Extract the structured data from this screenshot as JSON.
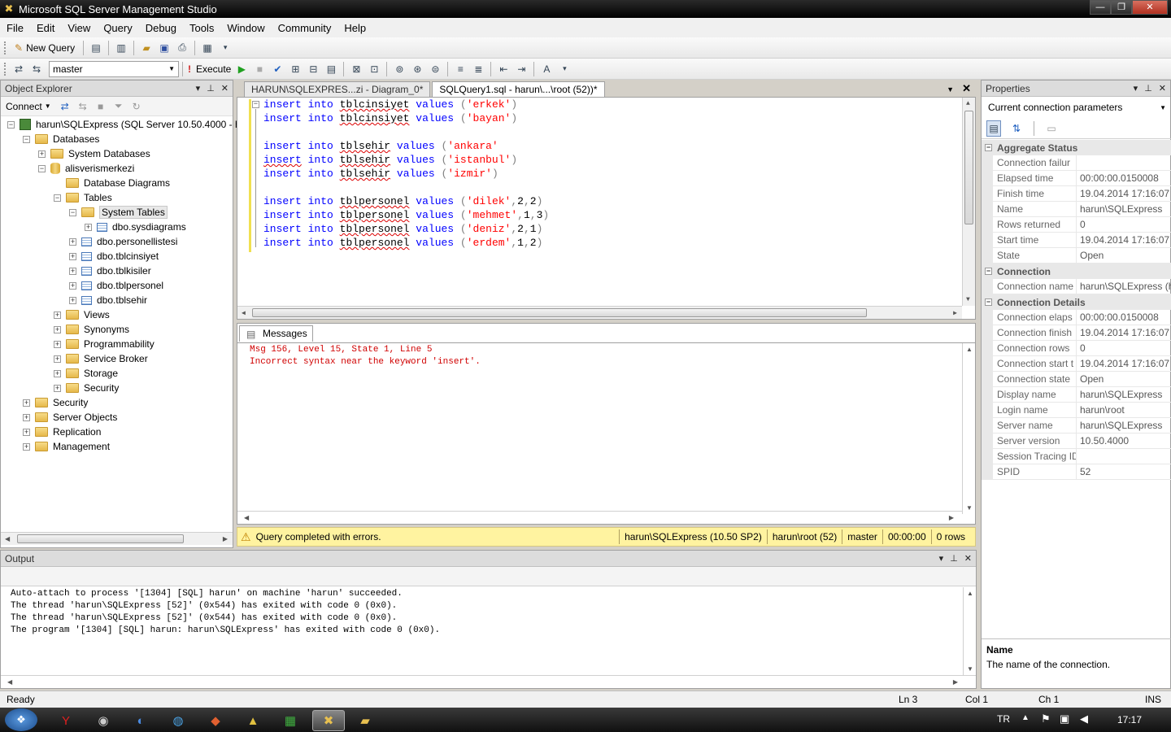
{
  "window": {
    "title": "Microsoft SQL Server Management Studio",
    "minimize": "—",
    "maximize": "❐",
    "close": "✕"
  },
  "menu": [
    "File",
    "Edit",
    "View",
    "Query",
    "Debug",
    "Tools",
    "Window",
    "Community",
    "Help"
  ],
  "toolbar1": {
    "new_query": "New Query"
  },
  "toolbar2": {
    "database": "master",
    "execute": "Execute"
  },
  "object_explorer": {
    "title": "Object Explorer",
    "connect": "Connect",
    "tree": [
      {
        "label": "harun\\SQLExpress (SQL Server 10.50.4000 - ha",
        "icon": "server",
        "exp": "−",
        "lvl": 0
      },
      {
        "label": "Databases",
        "icon": "folder",
        "exp": "−",
        "lvl": 1
      },
      {
        "label": "System Databases",
        "icon": "folder",
        "exp": "+",
        "lvl": 2
      },
      {
        "label": "alisverismerkezi",
        "icon": "db",
        "exp": "−",
        "lvl": 2
      },
      {
        "label": "Database Diagrams",
        "icon": "folder",
        "exp": "",
        "lvl": 3
      },
      {
        "label": "Tables",
        "icon": "folder",
        "exp": "−",
        "lvl": 3
      },
      {
        "label": "System Tables",
        "icon": "folder",
        "exp": "−",
        "lvl": 4,
        "selected": true
      },
      {
        "label": "dbo.sysdiagrams",
        "icon": "table",
        "exp": "+",
        "lvl": 5
      },
      {
        "label": "dbo.personellistesi",
        "icon": "table",
        "exp": "+",
        "lvl": 4
      },
      {
        "label": "dbo.tblcinsiyet",
        "icon": "table",
        "exp": "+",
        "lvl": 4
      },
      {
        "label": "dbo.tblkisiler",
        "icon": "table",
        "exp": "+",
        "lvl": 4
      },
      {
        "label": "dbo.tblpersonel",
        "icon": "table",
        "exp": "+",
        "lvl": 4
      },
      {
        "label": "dbo.tblsehir",
        "icon": "table",
        "exp": "+",
        "lvl": 4
      },
      {
        "label": "Views",
        "icon": "folder",
        "exp": "+",
        "lvl": 3
      },
      {
        "label": "Synonyms",
        "icon": "folder",
        "exp": "+",
        "lvl": 3
      },
      {
        "label": "Programmability",
        "icon": "folder",
        "exp": "+",
        "lvl": 3
      },
      {
        "label": "Service Broker",
        "icon": "folder",
        "exp": "+",
        "lvl": 3
      },
      {
        "label": "Storage",
        "icon": "folder",
        "exp": "+",
        "lvl": 3
      },
      {
        "label": "Security",
        "icon": "folder",
        "exp": "+",
        "lvl": 3
      },
      {
        "label": "Security",
        "icon": "folder",
        "exp": "+",
        "lvl": 1
      },
      {
        "label": "Server Objects",
        "icon": "folder",
        "exp": "+",
        "lvl": 1
      },
      {
        "label": "Replication",
        "icon": "folder",
        "exp": "+",
        "lvl": 1
      },
      {
        "label": "Management",
        "icon": "folder",
        "exp": "+",
        "lvl": 1
      }
    ]
  },
  "tabs": [
    {
      "label": "HARUN\\SQLEXPRES...zi - Diagram_0*",
      "active": false
    },
    {
      "label": "SQLQuery1.sql - harun\\...\\root (52))*",
      "active": true
    }
  ],
  "editor": {
    "lines": [
      {
        "table": "tblcinsiyet",
        "kw_gap": " ",
        "args": [
          [
            "str",
            "'erkek'"
          ]
        ]
      },
      {
        "table": "tblcinsiyet",
        "kw_gap": " ",
        "args": [
          [
            "str",
            "'bayan'"
          ]
        ]
      },
      null,
      {
        "table": "tblsehir",
        "kw_gap": " ",
        "args": [
          [
            "str",
            "'ankara'"
          ]
        ],
        "nopar": true
      },
      {
        "table": "tblsehir",
        "kw_gap": " ",
        "args": [
          [
            "str",
            "'istanbul'"
          ]
        ],
        "sq_insert": true
      },
      {
        "table": "tblsehir",
        "kw_gap": " ",
        "args": [
          [
            "str",
            "'izmir'"
          ]
        ]
      },
      null,
      {
        "table": "tblpersonel",
        "kw_gap": " ",
        "args": [
          [
            "str",
            "'dilek'"
          ],
          [
            "num",
            "2"
          ],
          [
            "num",
            "2"
          ]
        ]
      },
      {
        "table": "tblpersonel",
        "kw_gap": " ",
        "args": [
          [
            "str",
            "'mehmet'"
          ],
          [
            "num",
            "1"
          ],
          [
            "num",
            "3"
          ]
        ]
      },
      {
        "table": "tblpersonel",
        "kw_gap": " ",
        "args": [
          [
            "str",
            "'deniz'"
          ],
          [
            "num",
            "2"
          ],
          [
            "num",
            "1"
          ]
        ]
      },
      {
        "table": "tblpersonel",
        "kw_gap": " ",
        "args": [
          [
            "str",
            "'erdem'"
          ],
          [
            "num",
            "1"
          ],
          [
            "num",
            "2"
          ]
        ]
      }
    ],
    "kw_insert": "insert",
    "kw_into": "into",
    "kw_values": "values"
  },
  "messages": {
    "tab": "Messages",
    "line1": "Msg 156, Level 15, State 1, Line 5",
    "line2": "Incorrect syntax near the keyword 'insert'."
  },
  "query_status": {
    "text": "Query completed with errors.",
    "server": "harun\\SQLExpress (10.50 SP2)",
    "user": "harun\\root (52)",
    "db": "master",
    "time": "00:00:00",
    "rows": "0 rows"
  },
  "output": {
    "title": "Output",
    "lines": [
      "Auto-attach to process '[1304] [SQL] harun' on machine 'harun' succeeded.",
      "The thread 'harun\\SQLExpress [52]' (0x544) has exited with code 0 (0x0).",
      "The thread 'harun\\SQLExpress [52]' (0x544) has exited with code 0 (0x0).",
      "The program '[1304] [SQL] harun: harun\\SQLExpress' has exited with code 0 (0x0)."
    ]
  },
  "properties": {
    "title": "Properties",
    "selector": "Current connection parameters",
    "rows": [
      {
        "cat": "Aggregate Status"
      },
      {
        "n": "Connection failur",
        "v": ""
      },
      {
        "n": "Elapsed time",
        "v": "00:00:00.0150008"
      },
      {
        "n": "Finish time",
        "v": "19.04.2014 17:16:07"
      },
      {
        "n": "Name",
        "v": "harun\\SQLExpress"
      },
      {
        "n": "Rows returned",
        "v": "0"
      },
      {
        "n": "Start time",
        "v": "19.04.2014 17:16:07"
      },
      {
        "n": "State",
        "v": "Open"
      },
      {
        "cat": "Connection"
      },
      {
        "n": "Connection name",
        "v": "harun\\SQLExpress (ha"
      },
      {
        "cat": "Connection Details"
      },
      {
        "n": "Connection elaps",
        "v": "00:00:00.0150008"
      },
      {
        "n": "Connection finish",
        "v": "19.04.2014 17:16:07"
      },
      {
        "n": "Connection rows",
        "v": "0"
      },
      {
        "n": "Connection start t",
        "v": "19.04.2014 17:16:07"
      },
      {
        "n": "Connection state",
        "v": "Open"
      },
      {
        "n": "Display name",
        "v": "harun\\SQLExpress"
      },
      {
        "n": "Login name",
        "v": "harun\\root"
      },
      {
        "n": "Server name",
        "v": "harun\\SQLExpress"
      },
      {
        "n": "Server version",
        "v": "10.50.4000"
      },
      {
        "n": "Session Tracing ID",
        "v": ""
      },
      {
        "n": "SPID",
        "v": "52"
      }
    ],
    "desc_title": "Name",
    "desc_text": "The name of the connection."
  },
  "statusbar": {
    "ready": "Ready",
    "ln": "Ln 3",
    "col": "Col 1",
    "ch": "Ch 1",
    "ins": "INS"
  },
  "taskbar": {
    "lang": "TR",
    "clock": "17:17"
  }
}
